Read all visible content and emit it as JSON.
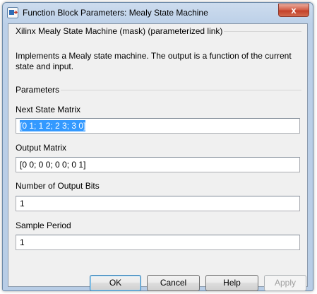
{
  "window": {
    "title": "Function Block Parameters: Mealy State Machine",
    "close_label": "x"
  },
  "header": {
    "block_name": "Xilinx Mealy State Machine (mask) (parameterized link)",
    "description": "Implements a Mealy state machine.  The output is a function of the current state and input."
  },
  "parameters": {
    "group_label": "Parameters",
    "next_state_matrix": {
      "label": "Next State Matrix",
      "value": "[0 1; 1 2; 2 3; 3 0]"
    },
    "output_matrix": {
      "label": "Output Matrix",
      "value": "[0 0; 0 0; 0 0; 0 1]"
    },
    "output_bits": {
      "label": "Number of  Output Bits",
      "value": "1"
    },
    "sample_period": {
      "label": "Sample Period",
      "value": "1"
    }
  },
  "buttons": {
    "ok": "OK",
    "cancel": "Cancel",
    "help": "Help",
    "apply": "Apply"
  }
}
